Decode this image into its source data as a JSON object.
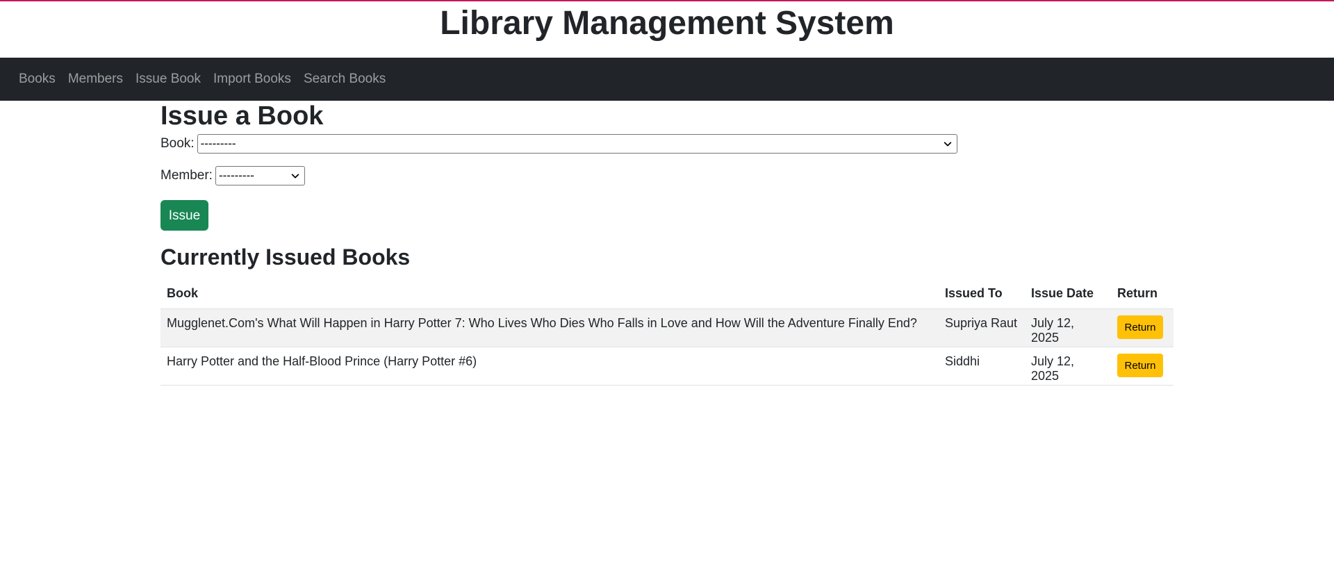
{
  "header": {
    "title": "Library Management System"
  },
  "nav": {
    "items": [
      {
        "label": "Books"
      },
      {
        "label": "Members"
      },
      {
        "label": "Issue Book"
      },
      {
        "label": "Import Books"
      },
      {
        "label": "Search Books"
      }
    ]
  },
  "issue_form": {
    "heading": "Issue a Book",
    "book_label": "Book:",
    "book_selected": "---------",
    "member_label": "Member:",
    "member_selected": "---------",
    "submit_label": "Issue"
  },
  "issued": {
    "heading": "Currently Issued Books",
    "columns": [
      "Book",
      "Issued To",
      "Issue Date",
      "Return"
    ],
    "rows": [
      {
        "book": "Mugglenet.Com's What Will Happen in Harry Potter 7: Who Lives Who Dies Who Falls in Love and How Will the Adventure Finally End?",
        "issued_to": "Supriya Raut",
        "issue_date": "July 12, 2025",
        "action": "Return"
      },
      {
        "book": "Harry Potter and the Half-Blood Prince (Harry Potter #6)",
        "issued_to": "Siddhi",
        "issue_date": "July 12, 2025",
        "action": "Return"
      }
    ]
  },
  "colors": {
    "accent": "#c2185b",
    "navbar": "#212529",
    "success": "#198754",
    "warning": "#ffc107"
  }
}
